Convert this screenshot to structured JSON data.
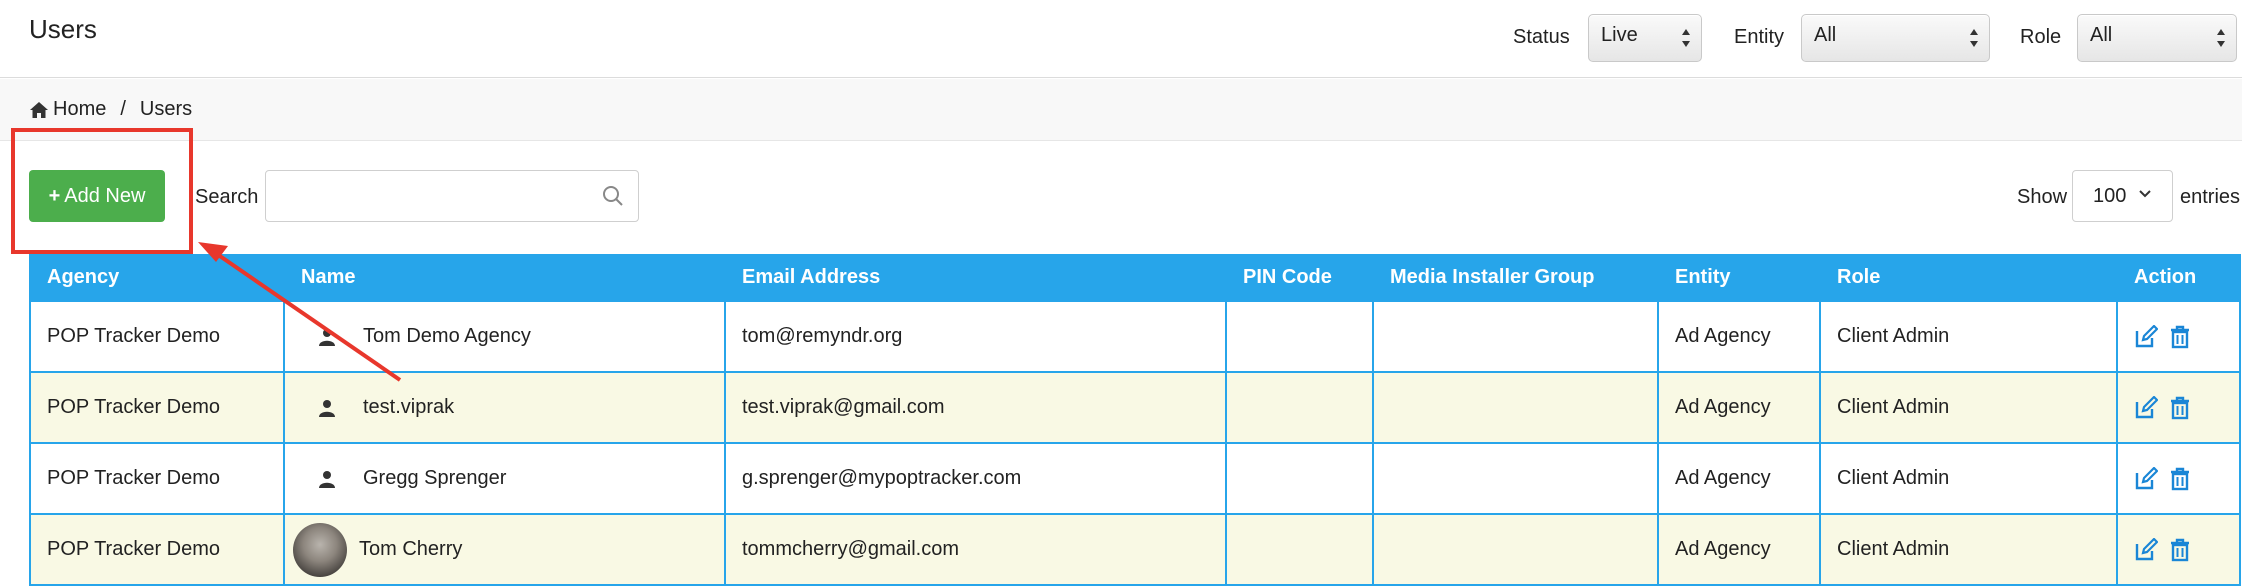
{
  "page": {
    "title": "Users"
  },
  "filters": [
    {
      "label": "Status",
      "value": "Live"
    },
    {
      "label": "Entity",
      "value": "All"
    },
    {
      "label": "Role",
      "value": "All"
    }
  ],
  "breadcrumb": {
    "home": "Home",
    "separator": "/",
    "current": "Users"
  },
  "toolbar": {
    "add_label": "Add New",
    "search_label": "Search",
    "search_value": "",
    "show_label": "Show",
    "show_value": "100",
    "entries_label": "entries"
  },
  "table": {
    "columns": [
      "Agency",
      "Name",
      "Email Address",
      "PIN Code",
      "Media Installer Group",
      "Entity",
      "Role",
      "Action"
    ],
    "rows": [
      {
        "agency": "POP Tracker Demo",
        "name": "Tom Demo Agency",
        "email": "tom@remyndr.org",
        "pin": "",
        "group": "",
        "entity": "Ad Agency",
        "role": "Client Admin",
        "avatar": "user-icon"
      },
      {
        "agency": "POP Tracker Demo",
        "name": "test.viprak",
        "email": "test.viprak@gmail.com",
        "pin": "",
        "group": "",
        "entity": "Ad Agency",
        "role": "Client Admin",
        "avatar": "user-icon"
      },
      {
        "agency": "POP Tracker Demo",
        "name": "Gregg Sprenger",
        "email": "g.sprenger@mypoptracker.com",
        "pin": "",
        "group": "",
        "entity": "Ad Agency",
        "role": "Client Admin",
        "avatar": "user-icon"
      },
      {
        "agency": "POP Tracker Demo",
        "name": "Tom Cherry",
        "email": "tommcherry@gmail.com",
        "pin": "",
        "group": "",
        "entity": "Ad Agency",
        "role": "Client Admin",
        "avatar": "photo"
      }
    ]
  },
  "colors": {
    "header_bg": "#27a5ea",
    "add_button": "#4cae4c",
    "row_alt": "#f9f9e4",
    "annotation": "#e8372c"
  }
}
